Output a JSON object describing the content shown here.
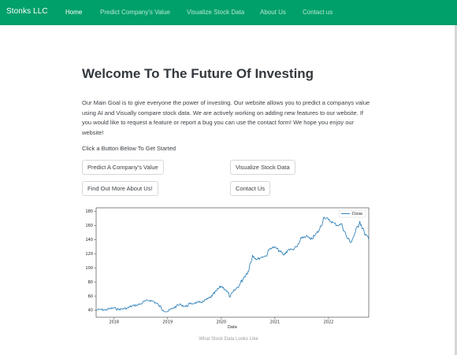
{
  "navbar": {
    "brand": "Stonks LLC",
    "links": [
      {
        "label": "Home",
        "active": true
      },
      {
        "label": "Predict Company's Value",
        "active": false
      },
      {
        "label": "Visualize Stock Data",
        "active": false
      },
      {
        "label": "About Us",
        "active": false
      },
      {
        "label": "Contact us",
        "active": false
      }
    ],
    "color": "#00a06a"
  },
  "hero": {
    "title": "Welcome To The Future Of Investing",
    "intro": "Our Main Goal is to give everyone the power of investing. Our website allows you to predict a companys value using AI and Visually compare stock data. We are actively working on adding new features to our website. If you would like to request a feature or report a bug you can use the contact form! We hope you enjoy our website!",
    "cta_label": "Click a Button Below To Get Started"
  },
  "buttons": {
    "predict": "Predict A Company's Value",
    "visualize": "Visualize Stock Data",
    "about": "Find Out More About Us!",
    "contact": "Contact Us"
  },
  "chart_data": {
    "type": "line",
    "title": "",
    "xlabel": "Date",
    "ylabel": "",
    "x_ticks": [
      "2018",
      "2019",
      "2020",
      "2021",
      "2022"
    ],
    "y_ticks": [
      40,
      60,
      80,
      100,
      120,
      140,
      160,
      180
    ],
    "xlim": [
      "2017-09",
      "2022-10"
    ],
    "ylim": [
      30,
      185
    ],
    "legend": "top-right",
    "grid": false,
    "series": [
      {
        "name": "Close",
        "color": "#1f77b4",
        "x": [
          "2017-09",
          "2017-10",
          "2017-11",
          "2017-12",
          "2018-01",
          "2018-02",
          "2018-03",
          "2018-04",
          "2018-05",
          "2018-06",
          "2018-07",
          "2018-08",
          "2018-09",
          "2018-10",
          "2018-11",
          "2018-12",
          "2019-01",
          "2019-02",
          "2019-03",
          "2019-04",
          "2019-05",
          "2019-06",
          "2019-07",
          "2019-08",
          "2019-09",
          "2019-10",
          "2019-11",
          "2019-12",
          "2020-01",
          "2020-02",
          "2020-03",
          "2020-04",
          "2020-05",
          "2020-06",
          "2020-07",
          "2020-08",
          "2020-09",
          "2020-10",
          "2020-11",
          "2020-12",
          "2021-01",
          "2021-02",
          "2021-03",
          "2021-04",
          "2021-05",
          "2021-06",
          "2021-07",
          "2021-08",
          "2021-09",
          "2021-10",
          "2021-11",
          "2021-12",
          "2022-01",
          "2022-02",
          "2022-03",
          "2022-04",
          "2022-05",
          "2022-06",
          "2022-07",
          "2022-08",
          "2022-09",
          "2022-10"
        ],
        "y": [
          40,
          41,
          40,
          42,
          43,
          41,
          42,
          43,
          46,
          47,
          49,
          53,
          54,
          52,
          47,
          40,
          38,
          42,
          46,
          48,
          45,
          49,
          50,
          51,
          52,
          56,
          60,
          68,
          74,
          69,
          59,
          68,
          75,
          86,
          95,
          118,
          112,
          115,
          117,
          128,
          129,
          124,
          118,
          126,
          126,
          130,
          142,
          145,
          140,
          146,
          154,
          172,
          168,
          164,
          160,
          162,
          144,
          136,
          150,
          166,
          150,
          140
        ]
      }
    ]
  },
  "caption": "What Stock Data Looks Like"
}
